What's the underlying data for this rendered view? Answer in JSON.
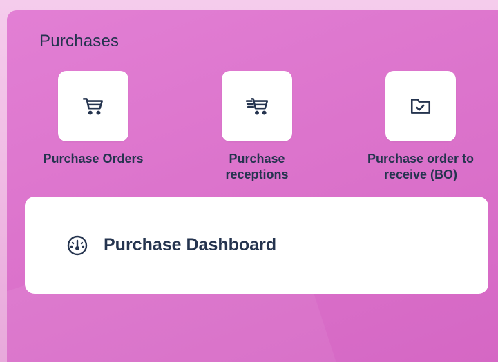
{
  "section": {
    "title": "Purchases"
  },
  "apps": [
    {
      "label": "Purchase Orders",
      "icon": "shopping-cart-icon"
    },
    {
      "label": "Purchase\nreceptions",
      "icon": "fast-cart-icon"
    },
    {
      "label": "Purchase order to\nreceive (BO)",
      "icon": "folder-check-icon"
    }
  ],
  "dashboard": {
    "label": "Purchase Dashboard",
    "icon": "gauge-icon"
  },
  "colors": {
    "panel": "#dc74cc",
    "text": "#25344f",
    "card": "#ffffff"
  }
}
